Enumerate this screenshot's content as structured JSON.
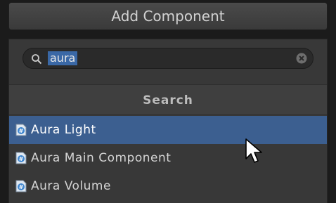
{
  "add_component_label": "Add Component",
  "search": {
    "value": "aura",
    "search_icon": "search-icon",
    "clear_icon": "clear-icon"
  },
  "header_label": "Search",
  "items": [
    {
      "label": "Aura Light",
      "icon": "csharp-script-icon",
      "selected": true
    },
    {
      "label": "Aura Main Component",
      "icon": "csharp-script-icon",
      "selected": false
    },
    {
      "label": "Aura Volume",
      "icon": "csharp-script-icon",
      "selected": false
    }
  ],
  "colors": {
    "selection": "#3c5f90",
    "text_highlight": "#3a68a6"
  }
}
